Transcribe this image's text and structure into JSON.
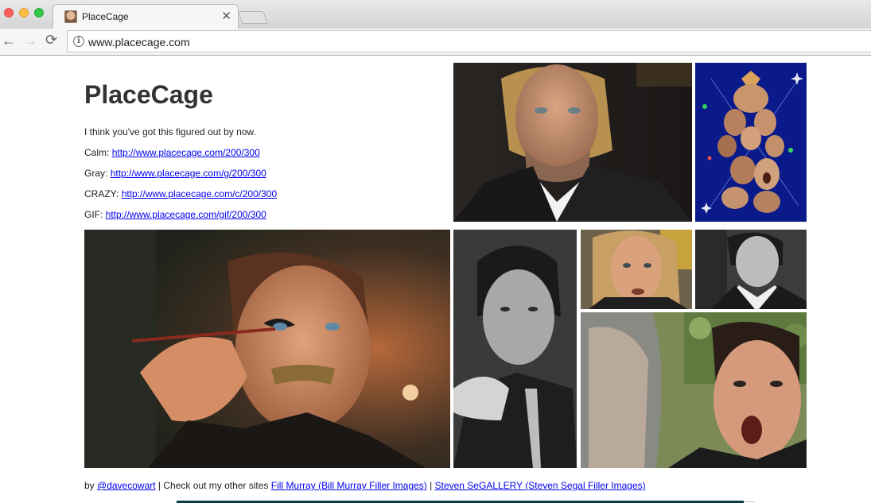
{
  "browser": {
    "tab_title": "PlaceCage",
    "tab_close": "✕",
    "url": "www.placecage.com",
    "back": "←",
    "forward": "→",
    "reload": "⟳",
    "info": "i"
  },
  "page": {
    "title": "PlaceCage",
    "intro": "I think you've got this figured out by now.",
    "links": [
      {
        "label": "Calm:",
        "url": "http://www.placecage.com/200/300"
      },
      {
        "label": "Gray:",
        "url": "http://www.placecage.com/g/200/300"
      },
      {
        "label": "CRAZY:",
        "url": "http://www.placecage.com/c/200/300"
      },
      {
        "label": "GIF:",
        "url": "http://www.placecage.com/gif/200/300"
      }
    ],
    "footer": {
      "by": "by",
      "author": "@davecowart",
      "sep1": "| Check out my other sites",
      "site1": "Fill Murray (Bill Murray Filler Images)",
      "sep2": "|",
      "site2": "Steven SeGALLERY (Steven Segal Filler Images)"
    }
  },
  "colors": {
    "link": "#0000ee",
    "title": "#333333"
  }
}
